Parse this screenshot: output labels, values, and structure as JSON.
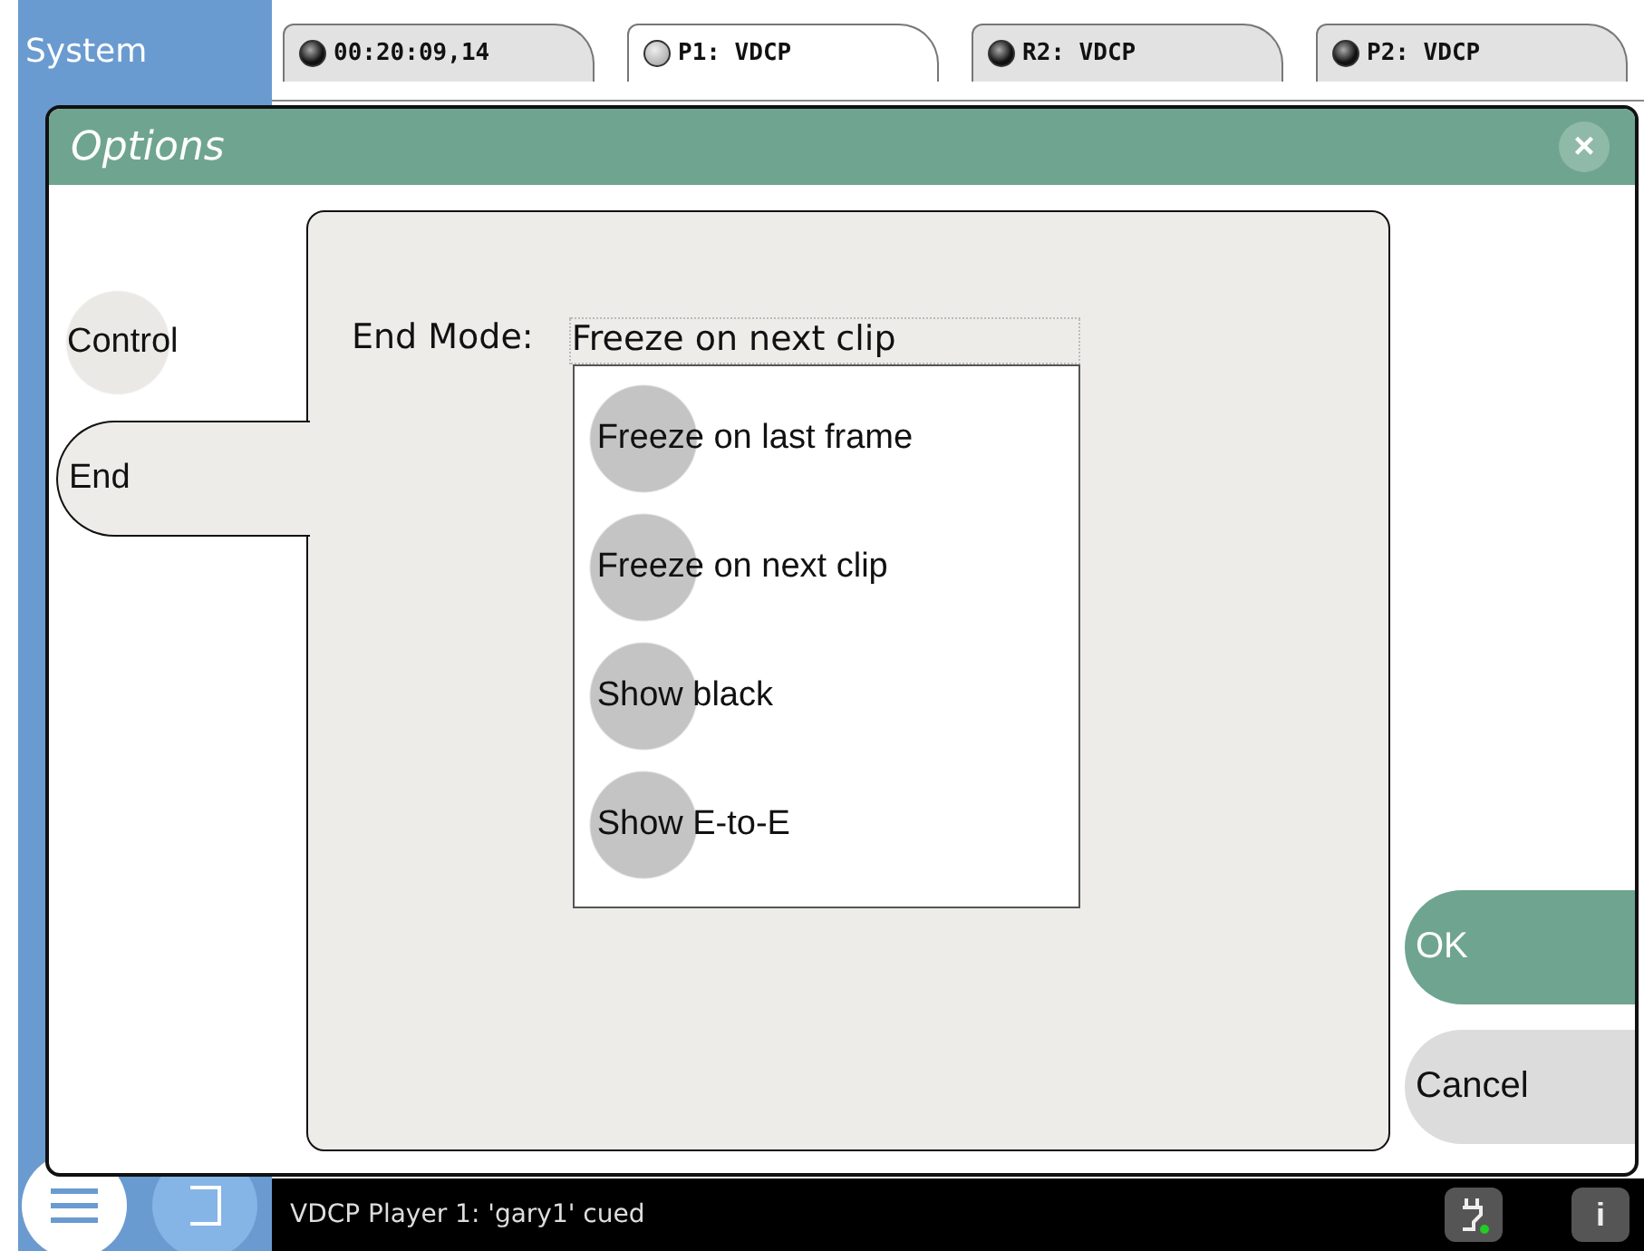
{
  "sidebar": {
    "title": "System"
  },
  "tabs": [
    {
      "label": "00:20:09,14",
      "selected": false
    },
    {
      "label": "P1: VDCP",
      "selected": true
    },
    {
      "label": "R2: VDCP",
      "selected": false
    },
    {
      "label": "P2: VDCP",
      "selected": false
    }
  ],
  "dialog": {
    "title": "Options",
    "close": "×",
    "side_tabs": [
      {
        "label": "Control",
        "selected": false
      },
      {
        "label": "End",
        "selected": true
      }
    ],
    "end_mode": {
      "label": "End Mode:",
      "value": "Freeze on next clip",
      "expanded": true,
      "options": [
        "Freeze on last frame",
        "Freeze on next clip",
        "Show black",
        "Show E-to-E"
      ]
    },
    "buttons": [
      {
        "label": "OK",
        "kind": "primary"
      },
      {
        "label": "Cancel",
        "kind": "secondary"
      }
    ]
  },
  "status_bar": {
    "message": "VDCP Player 1: 'gary1' cued",
    "info": "i"
  }
}
